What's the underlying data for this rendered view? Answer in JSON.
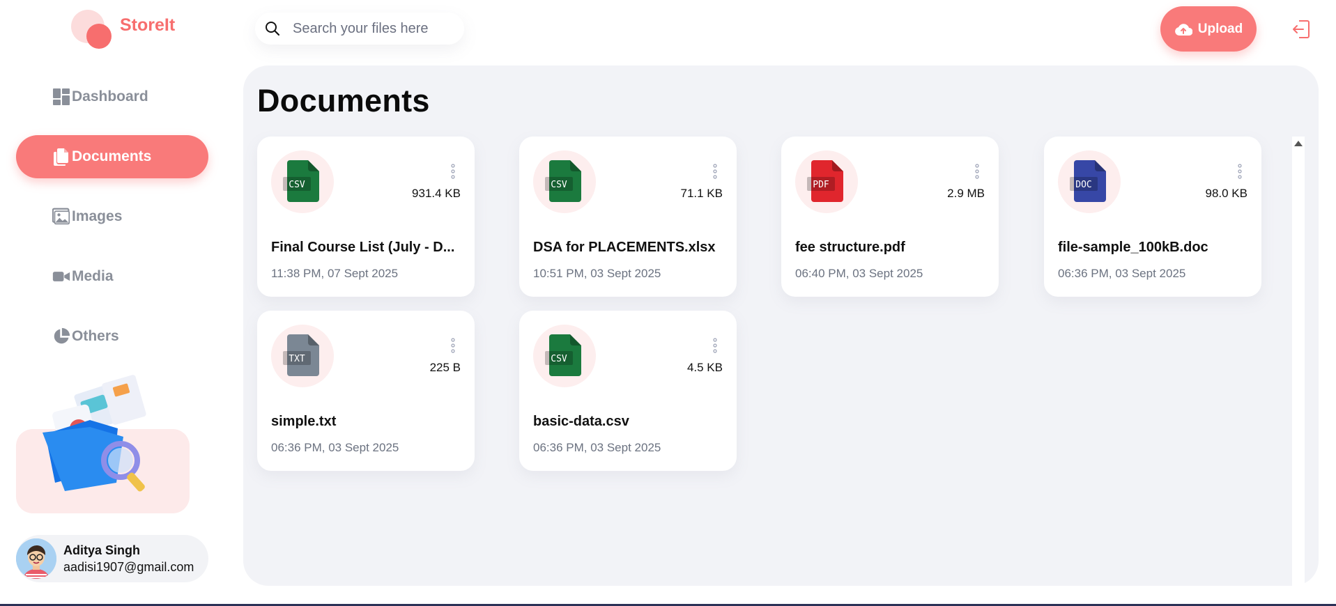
{
  "app": {
    "name": "StoreIt"
  },
  "sidebar": {
    "items": [
      {
        "label": "Dashboard",
        "icon": "dashboard-icon",
        "active": false
      },
      {
        "label": "Documents",
        "icon": "documents-icon",
        "active": true
      },
      {
        "label": "Images",
        "icon": "images-icon",
        "active": false
      },
      {
        "label": "Media",
        "icon": "media-icon",
        "active": false
      },
      {
        "label": "Others",
        "icon": "others-icon",
        "active": false
      }
    ],
    "promo_icon": "folder-search-illustration"
  },
  "header": {
    "search_placeholder": "Search your files here",
    "upload_label": "Upload",
    "upload_icon": "cloud-upload-icon",
    "logout_icon": "logout-icon"
  },
  "user": {
    "name": "Aditya Singh",
    "email": "aadisi1907@gmail.com"
  },
  "main": {
    "title": "Documents",
    "files": [
      {
        "type": "CSV",
        "color": "#1b7a3e",
        "size": "931.4 KB",
        "name": "Final Course List (July - D...",
        "date": "11:38 PM, 07 Sept 2025"
      },
      {
        "type": "CSV",
        "color": "#1b7a3e",
        "size": "71.1 KB",
        "name": "DSA for PLACEMENTS.xlsx",
        "date": "10:51 PM, 03 Sept 2025"
      },
      {
        "type": "PDF",
        "color": "#e0262d",
        "size": "2.9 MB",
        "name": "fee structure.pdf",
        "date": "06:40 PM, 03 Sept 2025"
      },
      {
        "type": "DOC",
        "color": "#3747a6",
        "size": "98.0 KB",
        "name": "file-sample_100kB.doc",
        "date": "06:36 PM, 03 Sept 2025"
      },
      {
        "type": "TXT",
        "color": "#7b8794",
        "size": "225 B",
        "name": "simple.txt",
        "date": "06:36 PM, 03 Sept 2025"
      },
      {
        "type": "CSV",
        "color": "#1b7a3e",
        "size": "4.5 KB",
        "name": "basic-data.csv",
        "date": "06:36 PM, 03 Sept 2025"
      }
    ]
  },
  "colors": {
    "brand": "#f76e6e",
    "brand_light": "#fdeaea",
    "main_bg": "#f2f3f7"
  }
}
